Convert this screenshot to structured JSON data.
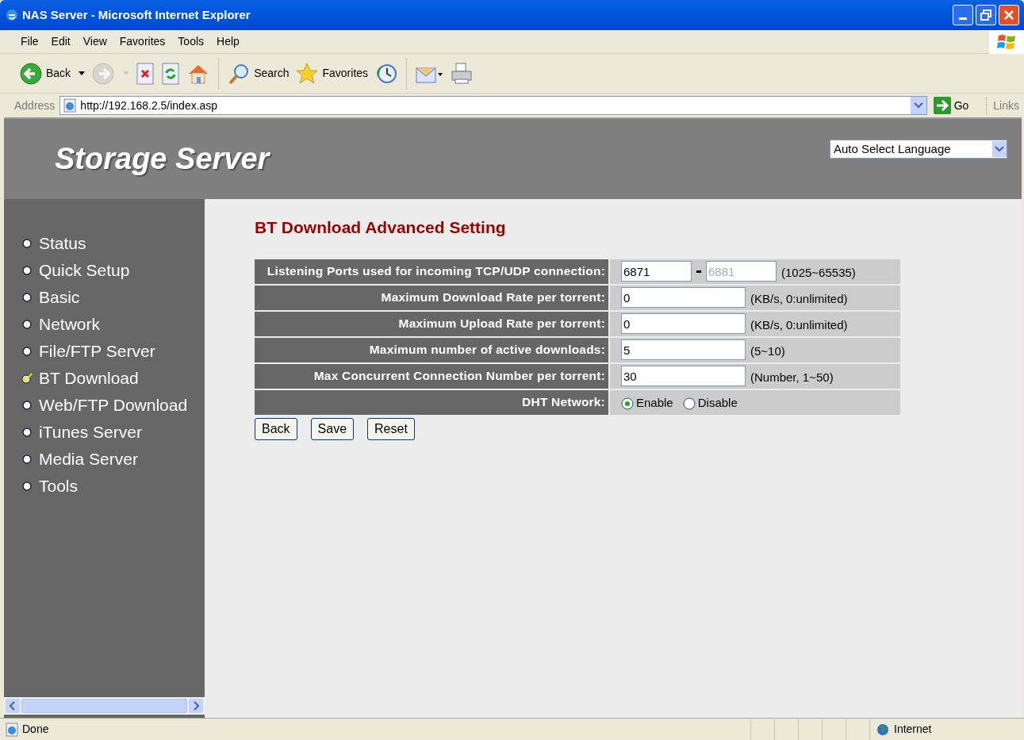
{
  "window": {
    "title": "NAS Server - Microsoft Internet Explorer"
  },
  "menu": [
    "File",
    "Edit",
    "View",
    "Favorites",
    "Tools",
    "Help"
  ],
  "toolbar": [
    {
      "kind": "back",
      "label": "Back",
      "disabled": false
    },
    {
      "kind": "forward",
      "disabled": true
    },
    {
      "kind": "stop",
      "disabled": false
    },
    {
      "kind": "refresh",
      "disabled": false
    },
    {
      "kind": "home",
      "disabled": false
    },
    {
      "kind": "search",
      "label": "Search",
      "disabled": false
    },
    {
      "kind": "favorites",
      "label": "Favorites",
      "disabled": false
    },
    {
      "kind": "history",
      "disabled": false
    },
    {
      "kind": "mail",
      "disabled": false
    },
    {
      "kind": "print",
      "disabled": false
    }
  ],
  "address_bar": {
    "label": "Address",
    "url": "http://192.168.2.5/index.asp",
    "go": "Go",
    "links": "Links"
  },
  "page": {
    "header": {
      "title": "Storage Server",
      "language": "Auto Select Language"
    },
    "sidebar": [
      {
        "label": "Status",
        "selected": false
      },
      {
        "label": "Quick Setup",
        "selected": false
      },
      {
        "label": "Basic",
        "selected": false
      },
      {
        "label": "Network",
        "selected": false
      },
      {
        "label": "File/FTP Server",
        "selected": false
      },
      {
        "label": "BT Download",
        "selected": true
      },
      {
        "label": "Web/FTP Download",
        "selected": false
      },
      {
        "label": "iTunes Server",
        "selected": false
      },
      {
        "label": "Media Server",
        "selected": false
      },
      {
        "label": "Tools",
        "selected": false
      }
    ],
    "heading": "BT Download Advanced Setting",
    "rows": [
      {
        "kind": "range",
        "label": "Listening Ports used for incoming TCP/UDP connection:",
        "fields": [
          {
            "value": "6871",
            "disabled": false
          },
          {
            "value": "6881",
            "disabled": true
          }
        ],
        "hint": "(1025~65535)"
      },
      {
        "kind": "text",
        "label": "Maximum Download Rate per torrent:",
        "fields": [
          {
            "value": "0",
            "disabled": false
          }
        ],
        "hint": "(KB/s, 0:unlimited)"
      },
      {
        "kind": "text",
        "label": "Maximum Upload Rate per torrent:",
        "fields": [
          {
            "value": "0",
            "disabled": false
          }
        ],
        "hint": "(KB/s, 0:unlimited)"
      },
      {
        "kind": "text",
        "label": "Maximum number of active downloads:",
        "fields": [
          {
            "value": "5",
            "disabled": false
          }
        ],
        "hint": "(5~10)"
      },
      {
        "kind": "text",
        "label": "Max Concurrent Connection Number per torrent:",
        "fields": [
          {
            "value": "30",
            "disabled": false
          }
        ],
        "hint": "(Number, 1~50)"
      },
      {
        "kind": "radio",
        "label": "DHT Network:",
        "options": [
          {
            "label": "Enable",
            "selected": true
          },
          {
            "label": "Disable",
            "selected": false
          }
        ]
      }
    ],
    "buttons": [
      "Back",
      "Save",
      "Reset"
    ]
  },
  "status_bar": {
    "text": "Done",
    "zone": "Internet"
  }
}
